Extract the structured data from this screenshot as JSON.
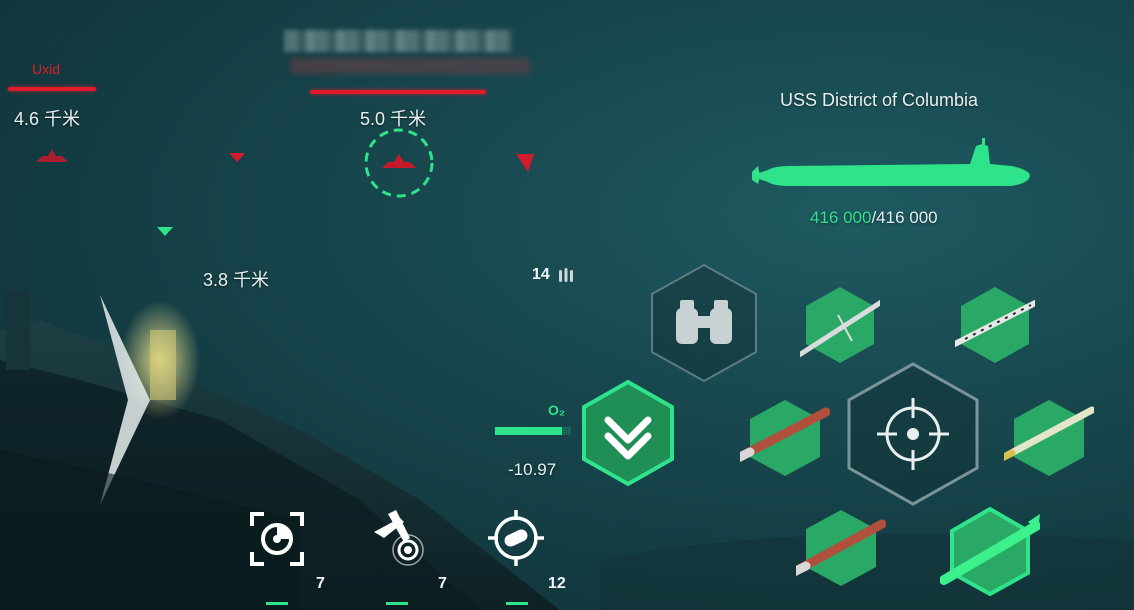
{
  "enemies": [
    {
      "name": "Uxid",
      "distance": "4.6 千米"
    },
    {
      "distance": "5.0 千米"
    },
    {
      "distance": "3.8 千米"
    }
  ],
  "player": {
    "ship_name": "USS District of Columbia",
    "hp_current": "416 000",
    "hp_max": "/416 000",
    "hp_fraction": 1.0
  },
  "ammo": {
    "count": "14"
  },
  "depth": {
    "o2_label": "O₂",
    "value": "-10.97"
  },
  "abilities": [
    {
      "icon": "sonar-target-icon",
      "count": "7"
    },
    {
      "icon": "aircraft-drone-icon",
      "count": "7"
    },
    {
      "icon": "scope-torpedo-icon",
      "count": "12"
    }
  ],
  "weapons": [
    {
      "icon": "binoculars-icon"
    },
    {
      "icon": "missile-icon"
    },
    {
      "icon": "cruise-missile-icon"
    },
    {
      "icon": "torpedo-icon"
    },
    {
      "icon": "crosshair-icon"
    },
    {
      "icon": "rocket-icon"
    },
    {
      "icon": "torpedo-icon"
    },
    {
      "icon": "green-torpedo-icon"
    }
  ],
  "colors": {
    "enemy": "#e01c2c",
    "friendly": "#2ee38a",
    "hex_green": "#2aa866"
  }
}
